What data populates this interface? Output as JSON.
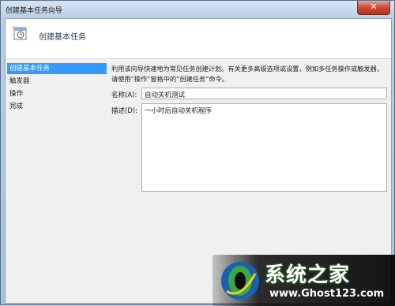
{
  "window": {
    "title": "创建基本任务向导",
    "close_glyph": "✕"
  },
  "header": {
    "title": "创建基本任务"
  },
  "nav": {
    "items": [
      {
        "label": "创建基本任务",
        "active": true
      },
      {
        "label": "触发器",
        "active": false
      },
      {
        "label": "操作",
        "active": false
      },
      {
        "label": "完成",
        "active": false
      }
    ]
  },
  "main": {
    "description": "利用该向导快速地为常见任务创建计划。有关更多高级选项或设置，例如多任务操作或触发器，请使用“操作”窗格中的“创建任务”命令。",
    "name_label": "名称(A):",
    "name_value": "自动关机测试",
    "desc_label": "描述(D):",
    "desc_value": "一小时后自动关机程序"
  },
  "watermark": {
    "text": "系统之家",
    "url": "www.Ghost123.com"
  },
  "icons": {
    "wizard": "task-wizard-icon",
    "logo": "system-home-logo"
  },
  "colors": {
    "accent": "#3399ff",
    "close": "#c9493a"
  }
}
